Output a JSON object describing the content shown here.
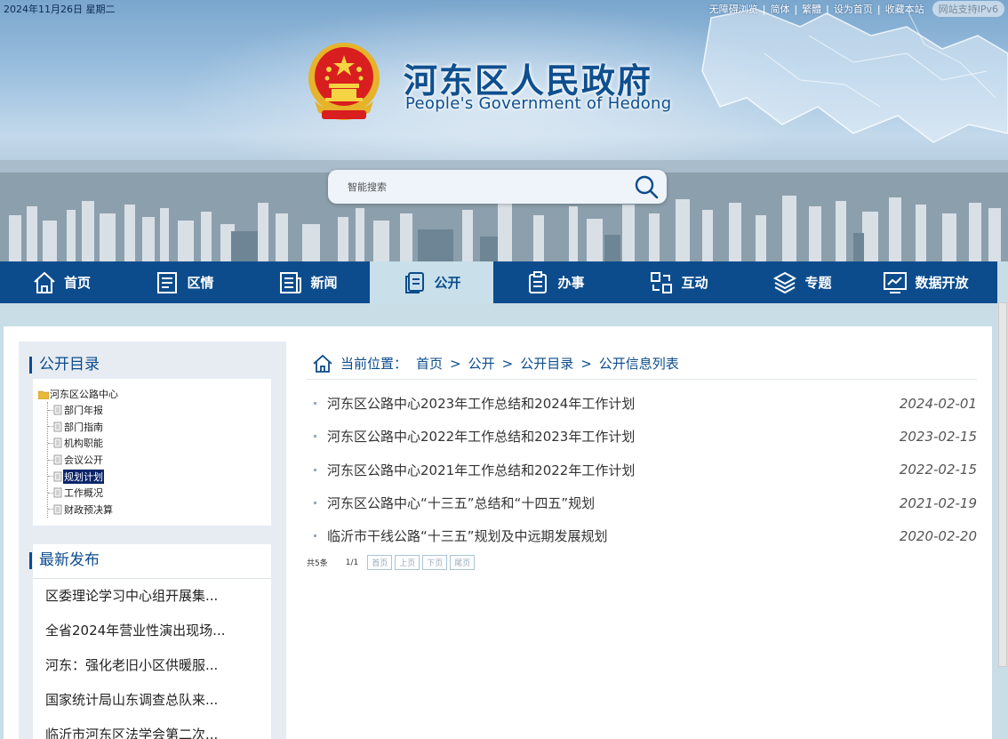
{
  "topbar": {
    "date": "2024年11月26日  星期二",
    "links": [
      "无障碍浏览",
      "简体",
      "繁體",
      "设为首页",
      "收藏本站"
    ],
    "ipv6_badge": "网站支持IPv6"
  },
  "header": {
    "title": "河东区人民政府",
    "subtitle": "People's Government of Hedong"
  },
  "search": {
    "placeholder": "智能搜索"
  },
  "nav": {
    "items": [
      {
        "label": "首页",
        "icon": "home-icon"
      },
      {
        "label": "区情",
        "icon": "document-icon"
      },
      {
        "label": "新闻",
        "icon": "news-icon"
      },
      {
        "label": "公开",
        "icon": "copy-icon",
        "active": true
      },
      {
        "label": "办事",
        "icon": "clipboard-icon"
      },
      {
        "label": "互动",
        "icon": "interact-icon"
      },
      {
        "label": "专题",
        "icon": "layers-icon"
      },
      {
        "label": "数据开放",
        "icon": "chart-icon"
      }
    ]
  },
  "sidebar": {
    "catalog_title": "公开目录",
    "tree_root": "河东区公路中心",
    "tree_items": [
      "部门年报",
      "部门指南",
      "机构职能",
      "会议公开",
      "规划计划",
      "工作概况",
      "财政预决算"
    ],
    "selected_index": 4,
    "latest_title": "最新发布",
    "latest_items": [
      "区委理论学习中心组开展集...",
      "全省2024年营业性演出现场...",
      "河东：强化老旧小区供暖服...",
      "国家统计局山东调查总队来...",
      "临沂市河东区法学会第二次..."
    ]
  },
  "breadcrumb": {
    "label": "当前位置：",
    "items": [
      "首页",
      "公开",
      "公开目录",
      "公开信息列表"
    ],
    "separator": ">"
  },
  "list": {
    "rows": [
      {
        "title": "河东区公路中心2023年工作总结和2024年工作计划",
        "date": "2024-02-01"
      },
      {
        "title": "河东区公路中心2022年工作总结和2023年工作计划",
        "date": "2023-02-15"
      },
      {
        "title": "河东区公路中心2021年工作总结和2022年工作计划",
        "date": "2022-02-15"
      },
      {
        "title": "河东区公路中心“十三五”总结和“十四五”规划",
        "date": "2021-02-19"
      },
      {
        "title": "临沂市干线公路“十三五”规划及中远期发展规划",
        "date": "2020-02-20"
      }
    ]
  },
  "pager": {
    "total": "共5条",
    "page": "1/1",
    "first": "首页",
    "prev": "上页",
    "next": "下页",
    "last": "尾页"
  },
  "colors": {
    "primary": "#0c4c8c",
    "nav_active_bg": "#c9e0ea",
    "page_bg": "#c9dde6",
    "sidebar_bg": "#e7ecf2"
  }
}
